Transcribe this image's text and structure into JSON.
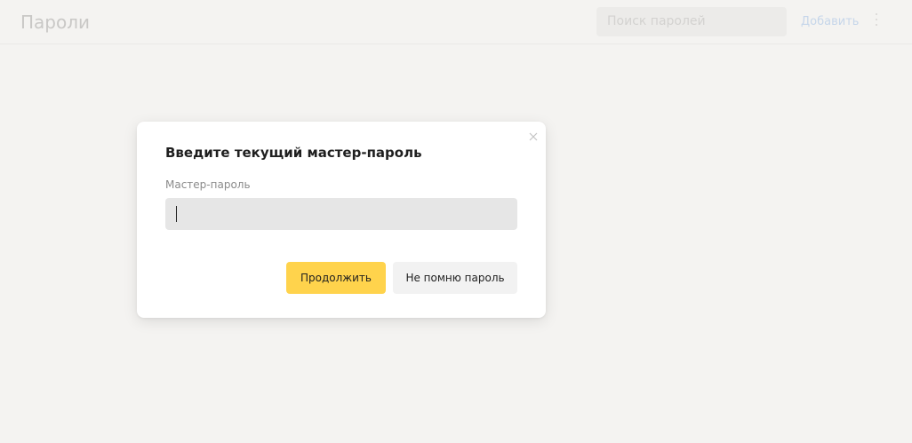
{
  "header": {
    "title": "Пароли",
    "search_placeholder": "Поиск паролей",
    "add_label": "Добавить",
    "more_icon": "more-vertical-icon"
  },
  "dialog": {
    "title": "Введите текущий мастер-пароль",
    "close_icon": "close-icon",
    "field_label": "Мастер-пароль",
    "field_value": "",
    "continue_label": "Продолжить",
    "forgot_label": "Не помню пароль"
  },
  "colors": {
    "background": "#f4f3f1",
    "primary_button": "#ffd34c",
    "secondary_button": "#f2f2f2",
    "input_background": "#e6e6e6",
    "link": "#c6d6ea"
  }
}
